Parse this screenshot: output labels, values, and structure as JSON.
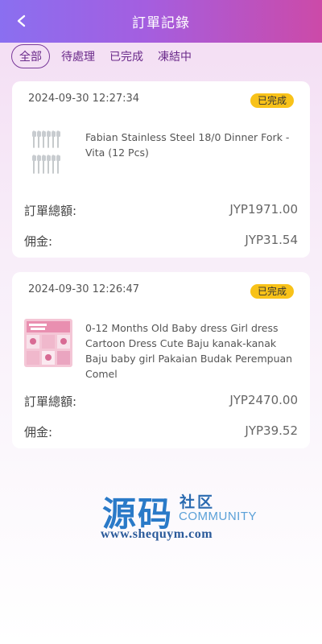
{
  "header": {
    "title": "訂單記錄",
    "back_icon": "chevron-left-icon"
  },
  "tabs": [
    {
      "label": "全部",
      "active": true
    },
    {
      "label": "待處理",
      "active": false
    },
    {
      "label": "已完成",
      "active": false
    },
    {
      "label": "凍結中",
      "active": false
    }
  ],
  "orders": [
    {
      "date": "2024-09-30 12:27:34",
      "status": "已完成",
      "product_name": "Fabian Stainless Steel 18/0 Dinner Fork - Vita (12 Pcs)",
      "total_label": "訂單總額:",
      "total_value": "JYP1971.00",
      "commission_label": "佣金:",
      "commission_value": "JYP31.54"
    },
    {
      "date": "2024-09-30 12:26:47",
      "status": "已完成",
      "product_name": "0-12 Months Old Baby dress Girl dress Cartoon Dress Cute Baju kanak-kanak Baju baby girl Pakaian Budak Perempuan Comel",
      "total_label": "訂單總額:",
      "total_value": "JYP2470.00",
      "commission_label": "佣金:",
      "commission_value": "JYP39.52"
    }
  ],
  "watermark": {
    "big": "源码",
    "small_cn": "社区",
    "community": "COMMUNITY",
    "url": "www.shequym.com"
  },
  "colors": {
    "header_start": "#8a6ff0",
    "header_end": "#cc4aa8",
    "badge": "#f8c219",
    "tab_text": "#6a2a8a"
  }
}
